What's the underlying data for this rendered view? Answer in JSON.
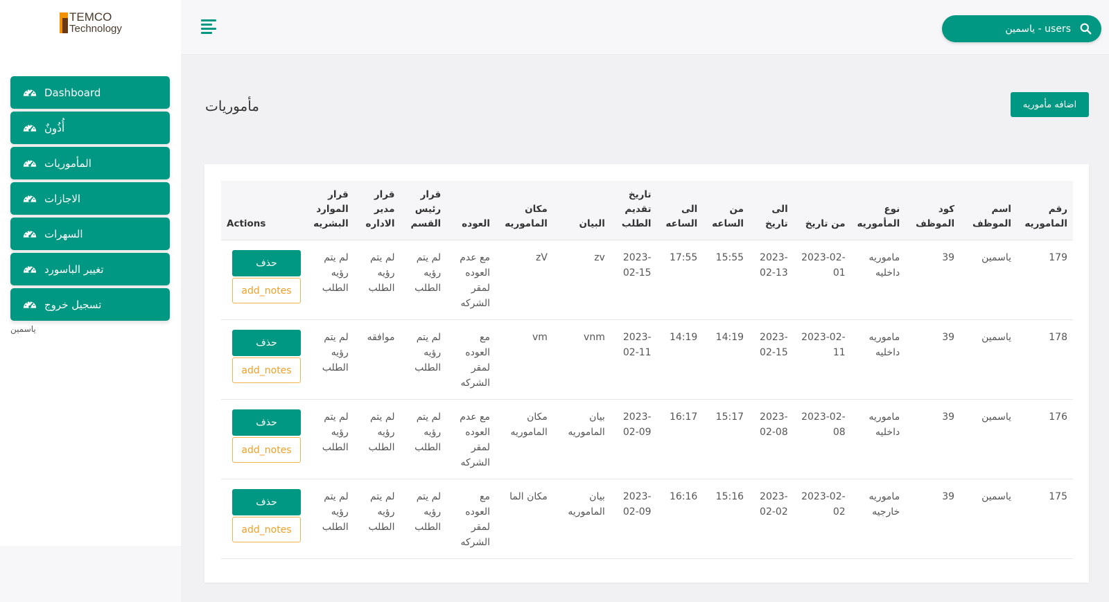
{
  "logo": {
    "line1": "TEMCO",
    "line2": "Technology"
  },
  "sidebar": {
    "items": [
      {
        "label": "Dashboard"
      },
      {
        "label": "أُذُونٌ"
      },
      {
        "label": "المأموريات"
      },
      {
        "label": "الاجازات"
      },
      {
        "label": "السهرات"
      },
      {
        "label": "تغيير الباسورد"
      },
      {
        "label": "تسجيل خروج"
      }
    ],
    "user_note": "ياسمين"
  },
  "search": {
    "value": "users - ياسمين"
  },
  "page": {
    "title": "مأموريات",
    "add_button": "اضافه مأموريه"
  },
  "table": {
    "headers": {
      "actions": "Actions",
      "hr": "قرار الموارد البشريه",
      "manager": "قرار مدير الاداره",
      "dept": "قرار رئيس القسم",
      "return": "العوده",
      "place": "مكان الماموريه",
      "desc": "البيان",
      "submit_date": "تاريخ تقديم الطلب",
      "to_time": "الى الساعه",
      "from_time": "من الساعه",
      "to_date": "الى تاريخ",
      "from_date": "من تاريخ",
      "type": "نوع المأموريه",
      "emp_code": "كود الموظف",
      "emp_name": "اسم الموظف",
      "number": "رقم الماموريه"
    },
    "delete_label": "حذف",
    "notes_label": "add_notes",
    "rows": [
      {
        "hr": "لم يتم رؤيه الطلب",
        "manager": "لم يتم رؤيه الطلب",
        "dept": "لم يتم رؤيه الطلب",
        "return": "مع عدم العوده لمقر الشركه",
        "place": "zV",
        "desc": "zv",
        "submit_date": "2023-02-15",
        "to_time": "17:55",
        "from_time": "15:55",
        "to_date": "2023-02-13",
        "from_date": "2023-02-01",
        "type": "ماموريه داخليه",
        "emp_code": "39",
        "emp_name": "ياسمين",
        "number": "179"
      },
      {
        "hr": "لم يتم رؤيه الطلب",
        "manager": "موافقه",
        "dept": "لم يتم رؤيه الطلب",
        "return": "مع العوده لمقر الشركه",
        "place": "vm",
        "desc": "vnm",
        "submit_date": "2023-02-11",
        "to_time": "14:19",
        "from_time": "14:19",
        "to_date": "2023-02-15",
        "from_date": "2023-02-11",
        "type": "ماموريه داخليه",
        "emp_code": "39",
        "emp_name": "ياسمين",
        "number": "178"
      },
      {
        "hr": "لم يتم رؤيه الطلب",
        "manager": "لم يتم رؤيه الطلب",
        "dept": "لم يتم رؤيه الطلب",
        "return": "مع عدم العوده لمقر الشركه",
        "place": "مكان الماموريه",
        "desc": "بيان الماموريه",
        "submit_date": "2023-02-09",
        "to_time": "16:17",
        "from_time": "15:17",
        "to_date": "2023-02-08",
        "from_date": "2023-02-08",
        "type": "ماموريه داخليه",
        "emp_code": "39",
        "emp_name": "ياسمين",
        "number": "176"
      },
      {
        "hr": "لم يتم رؤيه الطلب",
        "manager": "لم يتم رؤيه الطلب",
        "dept": "لم يتم رؤيه الطلب",
        "return": "مع العوده لمقر الشركه",
        "place": "مكان الما",
        "desc": "بيان الماموريه",
        "submit_date": "2023-02-09",
        "to_time": "16:16",
        "from_time": "15:16",
        "to_date": "2023-02-02",
        "from_date": "2023-02-02",
        "type": "ماموريه خارجيه",
        "emp_code": "39",
        "emp_name": "ياسمين",
        "number": "175"
      }
    ]
  },
  "colors": {
    "accent": "#009882",
    "notes_border": "#f3b24a",
    "logo_orange": "#f39200",
    "logo_brown": "#6b3a12"
  },
  "icons": {
    "nav": "speedometer-icon",
    "menu": "hamburger-icon",
    "search": "search-icon"
  }
}
